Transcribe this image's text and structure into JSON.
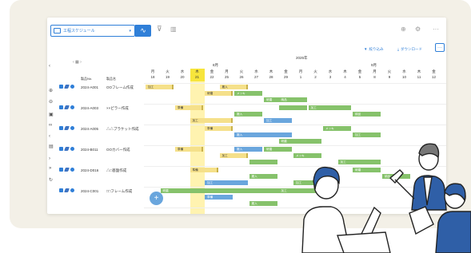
{
  "toolbar": {
    "view_name": "工程スケジュール",
    "filter_label": "絞り込み",
    "download_label": "ダウンロード",
    "more_label": "···",
    "icons": [
      "list-view-icon",
      "wave-chart-icon",
      "filter-icon",
      "bar-chart-icon",
      "plus-icon",
      "gear-icon",
      "ellipsis-icon"
    ]
  },
  "timeline": {
    "year": "2025年",
    "months": [
      "8月",
      "9月"
    ],
    "weekdays": [
      "月",
      "火",
      "水",
      "木",
      "金",
      "月",
      "火",
      "水",
      "木",
      "金",
      "月",
      "火",
      "水",
      "木",
      "金",
      "月",
      "火",
      "水",
      "木",
      "金"
    ],
    "dates": [
      "18",
      "19",
      "20",
      "21",
      "22",
      "25",
      "26",
      "27",
      "28",
      "29",
      "1",
      "2",
      "3",
      "4",
      "5",
      "8",
      "9",
      "10",
      "11",
      "12"
    ],
    "today_index": 3
  },
  "grid": {
    "columns": [
      "製品No.",
      "製品名"
    ],
    "rows": [
      {
        "no": "2024-A001",
        "name": "OOフレーム作成"
      },
      {
        "no": "2024-A003",
        "name": "××ピラー作成"
      },
      {
        "no": "2024-A005",
        "name": "△△ブラケット作成"
      },
      {
        "no": "2024-B011",
        "name": "OOカバー作成"
      },
      {
        "no": "2024-D016",
        "name": "△□基盤作成"
      },
      {
        "no": "2024-C001",
        "name": "□□フレーム作成"
      }
    ]
  },
  "bars": [
    {
      "row": 0,
      "label": "搬入",
      "start": 5,
      "len": 2,
      "color": "yellow"
    },
    {
      "row": 0,
      "label": "メッキ",
      "start": 6,
      "len": 2,
      "color": "green"
    },
    {
      "row": 0,
      "label": "研磨",
      "start": 8,
      "len": 2,
      "color": "green"
    },
    {
      "row": 0,
      "label": "加工",
      "start": 0,
      "len": 2,
      "color": "yellow"
    },
    {
      "row": 0,
      "label": "研磨",
      "start": 4,
      "len": 2,
      "color": "yellow"
    },
    {
      "row": 0,
      "label": "納品",
      "start": 9,
      "len": 2,
      "color": "green"
    },
    {
      "row": 1,
      "label": "準備",
      "start": 2,
      "len": 2,
      "color": "yellow"
    },
    {
      "row": 1,
      "label": "搬入",
      "start": 6,
      "len": 2,
      "color": "green"
    },
    {
      "row": 1,
      "label": "加工",
      "start": 8,
      "len": 2,
      "color": "blue"
    },
    {
      "row": 1,
      "label": "加工",
      "start": 11,
      "len": 3,
      "color": "green"
    },
    {
      "row": 1,
      "label": "納品",
      "start": 14,
      "len": 2,
      "color": "green"
    },
    {
      "row": 1,
      "label": "加工",
      "start": 3,
      "len": 3,
      "color": "yellow"
    },
    {
      "row": 1,
      "label": "",
      "start": 9,
      "len": 2,
      "color": "green"
    },
    {
      "row": 2,
      "label": "準備",
      "start": 4,
      "len": 2,
      "color": "yellow"
    },
    {
      "row": 2,
      "label": "搬入",
      "start": 6,
      "len": 4,
      "color": "blue"
    },
    {
      "row": 2,
      "label": "加工",
      "start": 10,
      "len": 2,
      "color": "green"
    },
    {
      "row": 2,
      "label": "メッキ",
      "start": 12,
      "len": 2,
      "color": "green"
    },
    {
      "row": 2,
      "label": "加工",
      "start": 14,
      "len": 2,
      "color": "green"
    },
    {
      "row": 2,
      "label": "研磨",
      "start": 9,
      "len": 2,
      "color": "green"
    },
    {
      "row": 3,
      "label": "準備",
      "start": 2,
      "len": 2,
      "color": "yellow"
    },
    {
      "row": 3,
      "label": "加工",
      "start": 5,
      "len": 2,
      "color": "yellow"
    },
    {
      "row": 3,
      "label": "",
      "start": 7,
      "len": 2,
      "color": "green"
    },
    {
      "row": 3,
      "label": "研磨",
      "start": 8,
      "len": 2,
      "color": "green"
    },
    {
      "row": 3,
      "label": "メッキ",
      "start": 10,
      "len": 2,
      "color": "green"
    },
    {
      "row": 3,
      "label": "加工",
      "start": 13,
      "len": 3,
      "color": "green"
    },
    {
      "row": 3,
      "label": "搬入",
      "start": 6,
      "len": 2,
      "color": "blue"
    },
    {
      "row": 4,
      "label": "準備",
      "start": 3,
      "len": 2,
      "color": "yellow"
    },
    {
      "row": 4,
      "label": "搬入",
      "start": 7,
      "len": 2,
      "color": "green"
    },
    {
      "row": 4,
      "label": "加工",
      "start": 10,
      "len": 3,
      "color": "green"
    },
    {
      "row": 4,
      "label": "研磨",
      "start": 14,
      "len": 2,
      "color": "green"
    },
    {
      "row": 4,
      "label": "納品",
      "start": 16,
      "len": 2,
      "color": "green"
    },
    {
      "row": 4,
      "label": "加工",
      "start": 4,
      "len": 3,
      "color": "blue"
    },
    {
      "row": 5,
      "label": "研磨",
      "start": 1,
      "len": 11,
      "color": "green"
    },
    {
      "row": 5,
      "label": "準備",
      "start": 4,
      "len": 2,
      "color": "blue"
    },
    {
      "row": 5,
      "label": "搬入",
      "start": 7,
      "len": 2,
      "color": "green"
    },
    {
      "row": 5,
      "label": "加工",
      "start": 9,
      "len": 2,
      "color": "green"
    }
  ]
}
